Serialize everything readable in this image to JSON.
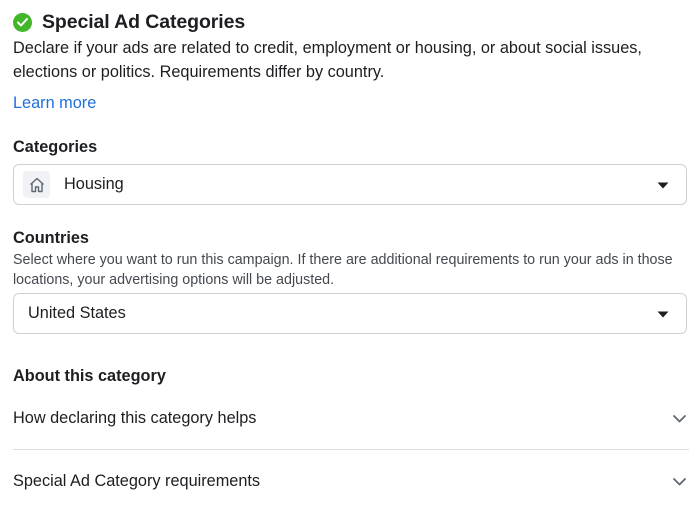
{
  "header": {
    "icon": "check-circle-icon",
    "title": "Special Ad Categories"
  },
  "description": "Declare if your ads are related to credit, employment or housing, or about social issues, elections or politics. Requirements differ by country.",
  "learn_more": "Learn more",
  "categories": {
    "label": "Categories",
    "icon": "house-icon",
    "selected": "Housing"
  },
  "countries": {
    "label": "Countries",
    "help": "Select where you want to run this campaign. If there are additional requirements to run your ads in those locations, your advertising options will be adjusted.",
    "selected": "United States"
  },
  "about": {
    "heading": "About this category",
    "items": [
      {
        "label": "How declaring this category helps"
      },
      {
        "label": "Special Ad Category requirements"
      }
    ]
  },
  "colors": {
    "accent_green": "#42b72a",
    "link_blue": "#216fdb",
    "text": "#1c1e21",
    "border": "#ccd0d5"
  }
}
